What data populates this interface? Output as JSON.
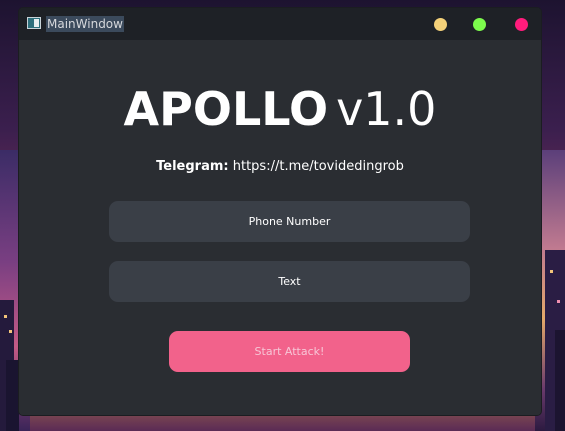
{
  "window": {
    "title": "MainWindow",
    "controls": {
      "minimize_color": "#f4d179",
      "maximize_color": "#7cfb4c",
      "close_color": "#ff1c7c"
    }
  },
  "header": {
    "name": "APOLLO",
    "version": "v1.0"
  },
  "telegram": {
    "label": "Telegram:",
    "url": "https://t.me/tovidedingrob"
  },
  "form": {
    "phone_placeholder": "Phone Number",
    "text_placeholder": "Text",
    "start_label": "Start Attack!"
  },
  "colors": {
    "window_bg": "#2a2d32",
    "titlebar_bg": "#1e2126",
    "field_bg": "#3a3f47",
    "accent": "#f2628b"
  },
  "icons": {
    "app": "app-window-icon",
    "minimize": "circle-yellow-icon",
    "maximize": "circle-green-icon",
    "close": "circle-pink-icon"
  }
}
